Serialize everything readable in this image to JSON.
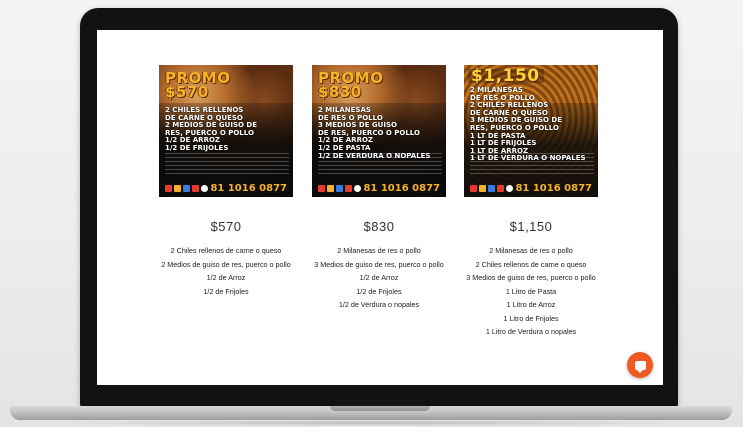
{
  "products": [
    {
      "promo_tag": "PROMO $570",
      "promo_lines": [
        "2 CHILES RELLENOS",
        "DE CARNE O QUESO",
        "2 MEDIOS DE GUISO DE",
        "RES, PUERCO O POLLO",
        "1/2 DE ARROZ",
        "1/2 DE FRIJOLES"
      ],
      "phone": "81 1016 0877",
      "price": "$570",
      "description": [
        "2 Chiles rellenos de carne o queso",
        "2 Medios de guiso de res, puerco o pollo",
        "1/2 de Arroz",
        "1/2 de Frijoles"
      ]
    },
    {
      "promo_tag": "PROMO $830",
      "promo_lines": [
        "2 MILANESAS",
        "DE RES O POLLO",
        "3 MEDIOS DE GUISO",
        "DE RES, PUERCO O POLLO",
        "1/2 DE ARROZ",
        "1/2 DE PASTA",
        "1/2 DE VERDURA O NOPALES"
      ],
      "phone": "81 1016 0877",
      "price": "$830",
      "description": [
        "2 Milanesas de res o pollo",
        "3 Medios de guiso de res, puerco o pollo",
        "1/2 de Arroz",
        "1/2 de Frijoles",
        "1/2 de Verdura o nopales"
      ]
    },
    {
      "promo_tag": "$1,150",
      "promo_lines": [
        "2 MILANESAS",
        "DE RES O POLLO",
        "2 CHILES RELLENOS",
        "DE CARNE O QUESO",
        "3 MEDIOS DE GUISO DE",
        "RES, PUERCO O POLLO",
        "1 LT DE PASTA",
        "1 LT DE FRIJOLES",
        "1 LT DE ARROZ",
        "1 LT DE VERDURA O NOPALES"
      ],
      "phone": "81 1016 0877",
      "price": "$1,150",
      "description": [
        "2 Milanesas de res o pollo",
        "2 Chiles rellenos de carne o queso",
        "3 Medios de guiso de res, puerco o pollo",
        "1 Litro de Pasta",
        "1 Litro de Arroz",
        "1 Litro de Frijoles",
        "1 Litro de Verdura o nopales"
      ]
    }
  ],
  "chat": {
    "icon": "chat-bubble-icon",
    "color": "#ef5a24"
  }
}
